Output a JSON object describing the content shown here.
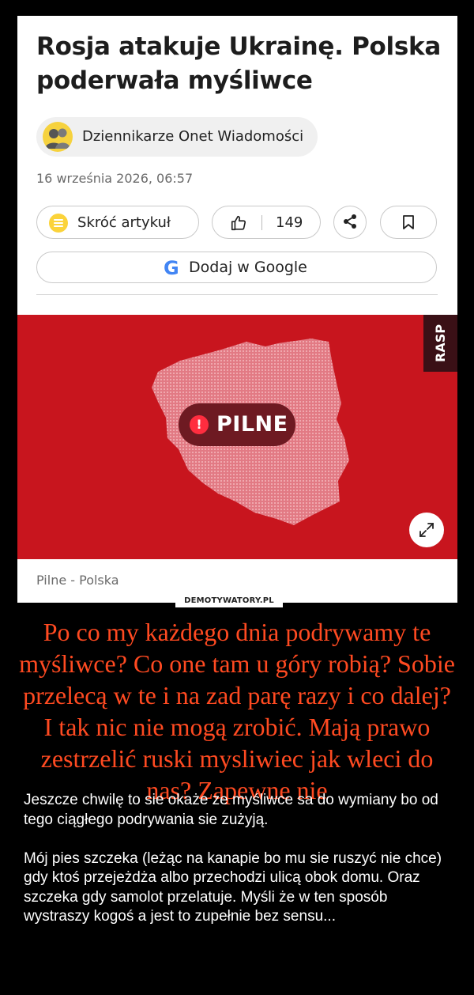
{
  "article": {
    "headline": "Rosja atakuje Ukrainę. Polska poderwała myśliwce",
    "author": "Dziennikarze Onet Wiadomości",
    "date": "16 września 2026, 06:57",
    "actions": {
      "shorten_label": "Skróć artykuł",
      "like_count": "149",
      "google_label": "Dodaj w Google",
      "google_letter": "G"
    },
    "hero": {
      "badge": "PILNE",
      "badge_icon": "!",
      "side_tab": "RASP",
      "background_color": "#c8151e",
      "badge_icon_color": "#ff2d3f"
    },
    "caption": "Pilne - Polska"
  },
  "icons": [
    "avatar-icon",
    "list-icon",
    "thumbs-up-icon",
    "share-icon",
    "bookmark-icon",
    "google-icon",
    "alert-icon",
    "expand-icon"
  ],
  "watermark": "DEMOTYWATORY.PL",
  "demotivator": {
    "title": "Po co my każdego dnia podrywamy te myśliwce? Co one tam u góry robią? Sobie przelecą w te i na zad parę razy i co dalej? I tak nic nie mogą zrobić. Mają prawo zestrzelić ruski mysliwiec jak wleci do nas? Zapewne nie",
    "title_color": "#ff4a21",
    "paragraphs": [
      "Jeszcze chwilę to sie okaże ze myśliwce sa do wymiany bo od tego ciągłego podrywania sie zużyją.",
      "Mój pies szczeka (leżąc na kanapie bo mu sie ruszyć nie chce) gdy ktoś przejeżdża albo przechodzi ulicą obok domu. Oraz szczeka gdy samolot przelatuje. Myśli że w ten sposób wystraszy kogoś a jest to zupełnie bez sensu..."
    ]
  }
}
